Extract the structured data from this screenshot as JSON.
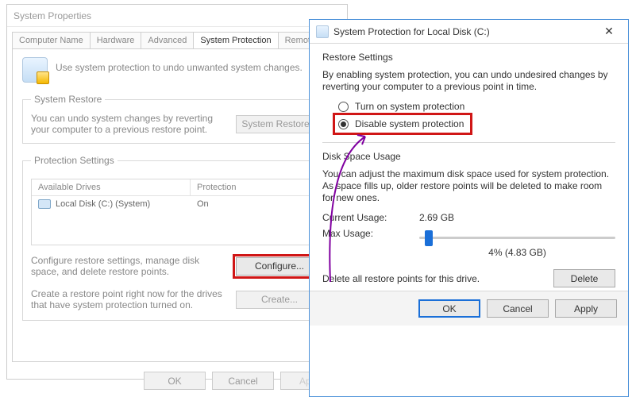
{
  "left": {
    "title": "System Properties",
    "tabs": [
      "Computer Name",
      "Hardware",
      "Advanced",
      "System Protection",
      "Remote"
    ],
    "intro": "Use system protection to undo unwanted system changes.",
    "restore": {
      "legend": "System Restore",
      "text": "You can undo system changes by reverting your computer to a previous restore point.",
      "button": "System Restore..."
    },
    "protection": {
      "legend": "Protection Settings",
      "col_drive": "Available Drives",
      "col_prot": "Protection",
      "drive_name": "Local Disk (C:) (System)",
      "drive_status": "On",
      "configure_text": "Configure restore settings, manage disk space, and delete restore points.",
      "configure_btn": "Configure...",
      "create_text": "Create a restore point right now for the drives that have system protection turned on.",
      "create_btn": "Create..."
    },
    "buttons": {
      "ok": "OK",
      "cancel": "Cancel",
      "apply": "Apply"
    }
  },
  "right": {
    "title": "System Protection for Local Disk (C:)",
    "restore_section": "Restore Settings",
    "restore_desc": "By enabling system protection, you can undo undesired changes by reverting your computer to a previous point in time.",
    "radio_on": "Turn on system protection",
    "radio_off": "Disable system protection",
    "disk_section": "Disk Space Usage",
    "disk_desc": "You can adjust the maximum disk space used for system protection. As space fills up, older restore points will be deleted to make room for new ones.",
    "current_label": "Current Usage:",
    "current_value": "2.69 GB",
    "max_label": "Max Usage:",
    "slider_label": "4% (4.83 GB)",
    "delete_text": "Delete all restore points for this drive.",
    "delete_btn": "Delete",
    "buttons": {
      "ok": "OK",
      "cancel": "Cancel",
      "apply": "Apply"
    }
  }
}
